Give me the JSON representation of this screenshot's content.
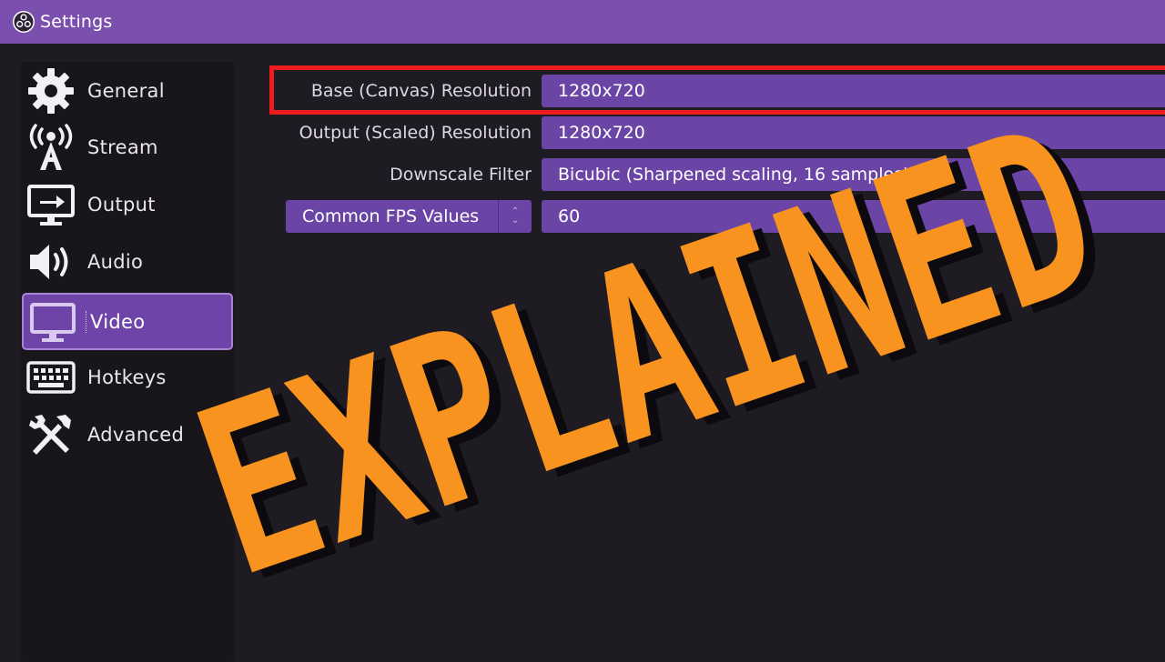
{
  "window": {
    "title": "Settings"
  },
  "sidebar": {
    "items": [
      {
        "label": "General",
        "icon": "gear-icon"
      },
      {
        "label": "Stream",
        "icon": "broadcast-tower-icon"
      },
      {
        "label": "Output",
        "icon": "monitor-output-icon"
      },
      {
        "label": "Audio",
        "icon": "speaker-icon"
      },
      {
        "label": "Video",
        "icon": "monitor-icon",
        "active": true
      },
      {
        "label": "Hotkeys",
        "icon": "keyboard-icon"
      },
      {
        "label": "Advanced",
        "icon": "tools-icon"
      }
    ]
  },
  "video": {
    "base_resolution": {
      "label": "Base (Canvas) Resolution",
      "value": "1280x720"
    },
    "output_resolution": {
      "label": "Output (Scaled) Resolution",
      "value": "1280x720"
    },
    "downscale_filter": {
      "label": "Downscale Filter",
      "value": "Bicubic (Sharpened scaling, 16 samples)"
    },
    "fps": {
      "mode": "Common FPS Values",
      "value": "60"
    }
  },
  "overlay": {
    "text": "EXPLAINED"
  },
  "colors": {
    "titlebar": "#7b4fae",
    "accent": "#6a45a6",
    "highlight": "#ee1d1d",
    "overlay_text": "#f7931e"
  }
}
